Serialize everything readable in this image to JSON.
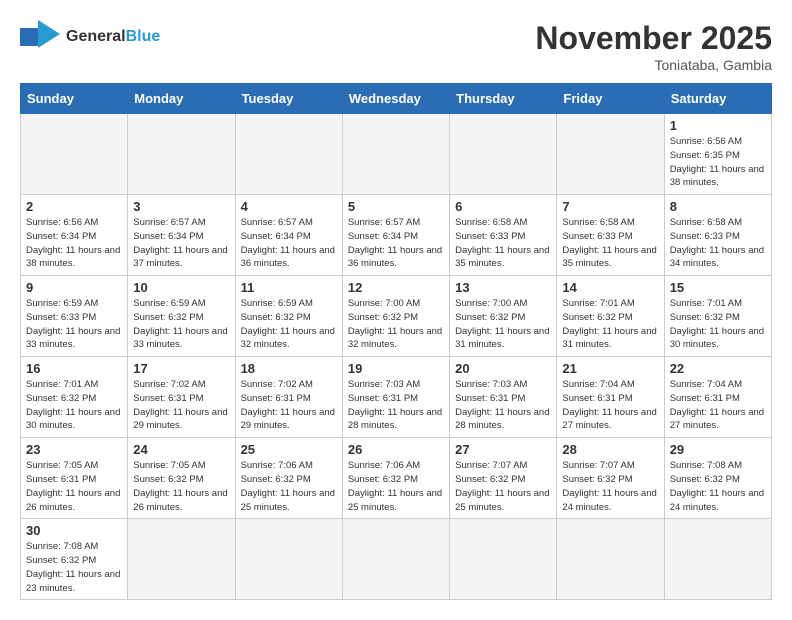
{
  "header": {
    "logo_general": "General",
    "logo_blue": "Blue",
    "month_year": "November 2025",
    "location": "Toniataba, Gambia"
  },
  "weekdays": [
    "Sunday",
    "Monday",
    "Tuesday",
    "Wednesday",
    "Thursday",
    "Friday",
    "Saturday"
  ],
  "weeks": [
    [
      {
        "day": "",
        "info": ""
      },
      {
        "day": "",
        "info": ""
      },
      {
        "day": "",
        "info": ""
      },
      {
        "day": "",
        "info": ""
      },
      {
        "day": "",
        "info": ""
      },
      {
        "day": "",
        "info": ""
      },
      {
        "day": "1",
        "info": "Sunrise: 6:56 AM\nSunset: 6:35 PM\nDaylight: 11 hours and 38 minutes."
      }
    ],
    [
      {
        "day": "2",
        "info": "Sunrise: 6:56 AM\nSunset: 6:34 PM\nDaylight: 11 hours and 38 minutes."
      },
      {
        "day": "3",
        "info": "Sunrise: 6:57 AM\nSunset: 6:34 PM\nDaylight: 11 hours and 37 minutes."
      },
      {
        "day": "4",
        "info": "Sunrise: 6:57 AM\nSunset: 6:34 PM\nDaylight: 11 hours and 36 minutes."
      },
      {
        "day": "5",
        "info": "Sunrise: 6:57 AM\nSunset: 6:34 PM\nDaylight: 11 hours and 36 minutes."
      },
      {
        "day": "6",
        "info": "Sunrise: 6:58 AM\nSunset: 6:33 PM\nDaylight: 11 hours and 35 minutes."
      },
      {
        "day": "7",
        "info": "Sunrise: 6:58 AM\nSunset: 6:33 PM\nDaylight: 11 hours and 35 minutes."
      },
      {
        "day": "8",
        "info": "Sunrise: 6:58 AM\nSunset: 6:33 PM\nDaylight: 11 hours and 34 minutes."
      }
    ],
    [
      {
        "day": "9",
        "info": "Sunrise: 6:59 AM\nSunset: 6:33 PM\nDaylight: 11 hours and 33 minutes."
      },
      {
        "day": "10",
        "info": "Sunrise: 6:59 AM\nSunset: 6:32 PM\nDaylight: 11 hours and 33 minutes."
      },
      {
        "day": "11",
        "info": "Sunrise: 6:59 AM\nSunset: 6:32 PM\nDaylight: 11 hours and 32 minutes."
      },
      {
        "day": "12",
        "info": "Sunrise: 7:00 AM\nSunset: 6:32 PM\nDaylight: 11 hours and 32 minutes."
      },
      {
        "day": "13",
        "info": "Sunrise: 7:00 AM\nSunset: 6:32 PM\nDaylight: 11 hours and 31 minutes."
      },
      {
        "day": "14",
        "info": "Sunrise: 7:01 AM\nSunset: 6:32 PM\nDaylight: 11 hours and 31 minutes."
      },
      {
        "day": "15",
        "info": "Sunrise: 7:01 AM\nSunset: 6:32 PM\nDaylight: 11 hours and 30 minutes."
      }
    ],
    [
      {
        "day": "16",
        "info": "Sunrise: 7:01 AM\nSunset: 6:32 PM\nDaylight: 11 hours and 30 minutes."
      },
      {
        "day": "17",
        "info": "Sunrise: 7:02 AM\nSunset: 6:31 PM\nDaylight: 11 hours and 29 minutes."
      },
      {
        "day": "18",
        "info": "Sunrise: 7:02 AM\nSunset: 6:31 PM\nDaylight: 11 hours and 29 minutes."
      },
      {
        "day": "19",
        "info": "Sunrise: 7:03 AM\nSunset: 6:31 PM\nDaylight: 11 hours and 28 minutes."
      },
      {
        "day": "20",
        "info": "Sunrise: 7:03 AM\nSunset: 6:31 PM\nDaylight: 11 hours and 28 minutes."
      },
      {
        "day": "21",
        "info": "Sunrise: 7:04 AM\nSunset: 6:31 PM\nDaylight: 11 hours and 27 minutes."
      },
      {
        "day": "22",
        "info": "Sunrise: 7:04 AM\nSunset: 6:31 PM\nDaylight: 11 hours and 27 minutes."
      }
    ],
    [
      {
        "day": "23",
        "info": "Sunrise: 7:05 AM\nSunset: 6:31 PM\nDaylight: 11 hours and 26 minutes."
      },
      {
        "day": "24",
        "info": "Sunrise: 7:05 AM\nSunset: 6:32 PM\nDaylight: 11 hours and 26 minutes."
      },
      {
        "day": "25",
        "info": "Sunrise: 7:06 AM\nSunset: 6:32 PM\nDaylight: 11 hours and 25 minutes."
      },
      {
        "day": "26",
        "info": "Sunrise: 7:06 AM\nSunset: 6:32 PM\nDaylight: 11 hours and 25 minutes."
      },
      {
        "day": "27",
        "info": "Sunrise: 7:07 AM\nSunset: 6:32 PM\nDaylight: 11 hours and 25 minutes."
      },
      {
        "day": "28",
        "info": "Sunrise: 7:07 AM\nSunset: 6:32 PM\nDaylight: 11 hours and 24 minutes."
      },
      {
        "day": "29",
        "info": "Sunrise: 7:08 AM\nSunset: 6:32 PM\nDaylight: 11 hours and 24 minutes."
      }
    ],
    [
      {
        "day": "30",
        "info": "Sunrise: 7:08 AM\nSunset: 6:32 PM\nDaylight: 11 hours and 23 minutes."
      },
      {
        "day": "",
        "info": ""
      },
      {
        "day": "",
        "info": ""
      },
      {
        "day": "",
        "info": ""
      },
      {
        "day": "",
        "info": ""
      },
      {
        "day": "",
        "info": ""
      },
      {
        "day": "",
        "info": ""
      }
    ]
  ]
}
